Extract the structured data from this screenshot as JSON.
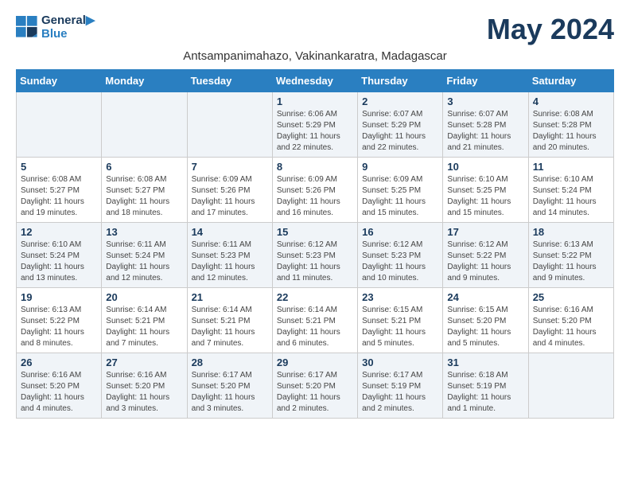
{
  "header": {
    "logo_line1": "General",
    "logo_line2": "Blue",
    "title": "May 2024",
    "subtitle": "Antsampanimahazo, Vakinankaratra, Madagascar"
  },
  "days_of_week": [
    "Sunday",
    "Monday",
    "Tuesday",
    "Wednesday",
    "Thursday",
    "Friday",
    "Saturday"
  ],
  "weeks": [
    [
      {
        "day": "",
        "info": ""
      },
      {
        "day": "",
        "info": ""
      },
      {
        "day": "",
        "info": ""
      },
      {
        "day": "1",
        "info": "Sunrise: 6:06 AM\nSunset: 5:29 PM\nDaylight: 11 hours\nand 22 minutes."
      },
      {
        "day": "2",
        "info": "Sunrise: 6:07 AM\nSunset: 5:29 PM\nDaylight: 11 hours\nand 22 minutes."
      },
      {
        "day": "3",
        "info": "Sunrise: 6:07 AM\nSunset: 5:28 PM\nDaylight: 11 hours\nand 21 minutes."
      },
      {
        "day": "4",
        "info": "Sunrise: 6:08 AM\nSunset: 5:28 PM\nDaylight: 11 hours\nand 20 minutes."
      }
    ],
    [
      {
        "day": "5",
        "info": "Sunrise: 6:08 AM\nSunset: 5:27 PM\nDaylight: 11 hours\nand 19 minutes."
      },
      {
        "day": "6",
        "info": "Sunrise: 6:08 AM\nSunset: 5:27 PM\nDaylight: 11 hours\nand 18 minutes."
      },
      {
        "day": "7",
        "info": "Sunrise: 6:09 AM\nSunset: 5:26 PM\nDaylight: 11 hours\nand 17 minutes."
      },
      {
        "day": "8",
        "info": "Sunrise: 6:09 AM\nSunset: 5:26 PM\nDaylight: 11 hours\nand 16 minutes."
      },
      {
        "day": "9",
        "info": "Sunrise: 6:09 AM\nSunset: 5:25 PM\nDaylight: 11 hours\nand 15 minutes."
      },
      {
        "day": "10",
        "info": "Sunrise: 6:10 AM\nSunset: 5:25 PM\nDaylight: 11 hours\nand 15 minutes."
      },
      {
        "day": "11",
        "info": "Sunrise: 6:10 AM\nSunset: 5:24 PM\nDaylight: 11 hours\nand 14 minutes."
      }
    ],
    [
      {
        "day": "12",
        "info": "Sunrise: 6:10 AM\nSunset: 5:24 PM\nDaylight: 11 hours\nand 13 minutes."
      },
      {
        "day": "13",
        "info": "Sunrise: 6:11 AM\nSunset: 5:24 PM\nDaylight: 11 hours\nand 12 minutes."
      },
      {
        "day": "14",
        "info": "Sunrise: 6:11 AM\nSunset: 5:23 PM\nDaylight: 11 hours\nand 12 minutes."
      },
      {
        "day": "15",
        "info": "Sunrise: 6:12 AM\nSunset: 5:23 PM\nDaylight: 11 hours\nand 11 minutes."
      },
      {
        "day": "16",
        "info": "Sunrise: 6:12 AM\nSunset: 5:23 PM\nDaylight: 11 hours\nand 10 minutes."
      },
      {
        "day": "17",
        "info": "Sunrise: 6:12 AM\nSunset: 5:22 PM\nDaylight: 11 hours\nand 9 minutes."
      },
      {
        "day": "18",
        "info": "Sunrise: 6:13 AM\nSunset: 5:22 PM\nDaylight: 11 hours\nand 9 minutes."
      }
    ],
    [
      {
        "day": "19",
        "info": "Sunrise: 6:13 AM\nSunset: 5:22 PM\nDaylight: 11 hours\nand 8 minutes."
      },
      {
        "day": "20",
        "info": "Sunrise: 6:14 AM\nSunset: 5:21 PM\nDaylight: 11 hours\nand 7 minutes."
      },
      {
        "day": "21",
        "info": "Sunrise: 6:14 AM\nSunset: 5:21 PM\nDaylight: 11 hours\nand 7 minutes."
      },
      {
        "day": "22",
        "info": "Sunrise: 6:14 AM\nSunset: 5:21 PM\nDaylight: 11 hours\nand 6 minutes."
      },
      {
        "day": "23",
        "info": "Sunrise: 6:15 AM\nSunset: 5:21 PM\nDaylight: 11 hours\nand 5 minutes."
      },
      {
        "day": "24",
        "info": "Sunrise: 6:15 AM\nSunset: 5:20 PM\nDaylight: 11 hours\nand 5 minutes."
      },
      {
        "day": "25",
        "info": "Sunrise: 6:16 AM\nSunset: 5:20 PM\nDaylight: 11 hours\nand 4 minutes."
      }
    ],
    [
      {
        "day": "26",
        "info": "Sunrise: 6:16 AM\nSunset: 5:20 PM\nDaylight: 11 hours\nand 4 minutes."
      },
      {
        "day": "27",
        "info": "Sunrise: 6:16 AM\nSunset: 5:20 PM\nDaylight: 11 hours\nand 3 minutes."
      },
      {
        "day": "28",
        "info": "Sunrise: 6:17 AM\nSunset: 5:20 PM\nDaylight: 11 hours\nand 3 minutes."
      },
      {
        "day": "29",
        "info": "Sunrise: 6:17 AM\nSunset: 5:20 PM\nDaylight: 11 hours\nand 2 minutes."
      },
      {
        "day": "30",
        "info": "Sunrise: 6:17 AM\nSunset: 5:19 PM\nDaylight: 11 hours\nand 2 minutes."
      },
      {
        "day": "31",
        "info": "Sunrise: 6:18 AM\nSunset: 5:19 PM\nDaylight: 11 hours\nand 1 minute."
      },
      {
        "day": "",
        "info": ""
      }
    ]
  ]
}
